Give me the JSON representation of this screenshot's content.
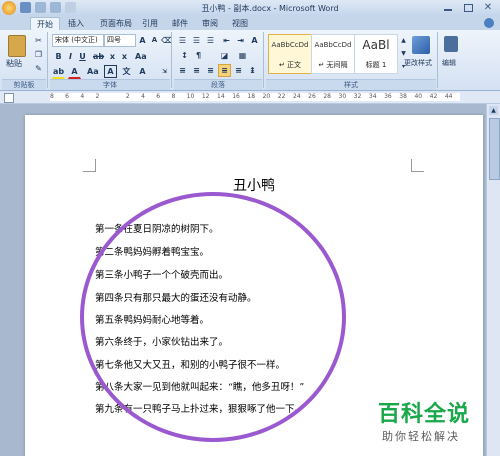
{
  "window": {
    "title": "丑小鸭 - 副本.docx - Microsoft Word"
  },
  "tabs": [
    {
      "label": "开始",
      "active": true
    },
    {
      "label": "插入"
    },
    {
      "label": "页面布局"
    },
    {
      "label": "引用"
    },
    {
      "label": "邮件"
    },
    {
      "label": "审阅"
    },
    {
      "label": "视图"
    }
  ],
  "ribbon": {
    "clipboard": {
      "paste_label": "粘贴",
      "group_label": "剪贴板"
    },
    "font": {
      "font_name": "宋体 (中文正)",
      "font_size": "四号",
      "group_label": "字体"
    },
    "paragraph": {
      "group_label": "段落"
    },
    "styles": {
      "items": [
        {
          "preview": "AaBbCcDd",
          "name": "↵ 正文",
          "selected": true
        },
        {
          "preview": "AaBbCcDd",
          "name": "↵ 无间隔"
        },
        {
          "preview": "AaBl",
          "name": "标题 1"
        }
      ],
      "change_label": "更改样式",
      "group_label": "样式"
    },
    "edit": {
      "label": "编辑"
    }
  },
  "ruler": {
    "ticks": [
      "8",
      "6",
      "4",
      "2",
      "",
      "2",
      "4",
      "6",
      "8",
      "10",
      "12",
      "14",
      "16",
      "18",
      "20",
      "22",
      "24",
      "26",
      "28",
      "30",
      "32",
      "34",
      "36",
      "38",
      "40",
      "42",
      "44"
    ]
  },
  "document": {
    "title": "丑小鸭",
    "lines": [
      "第一条在夏日阴凉的树阴下。",
      "第二条鸭妈妈孵着鸭宝宝。",
      "第三条小鸭子一个个破壳而出。",
      "第四条只有那只最大的蛋还没有动静。",
      "第五条鸭妈妈耐心地等着。",
      "第六条终于，小家伙钻出来了。",
      "第七条他又大又丑，和别的小鸭子很不一样。",
      "第八条大家一见到他就叫起来：“瞧，他多丑呀！”",
      "第九条有一只鸭子马上扑过来，狠狠啄了他一下。"
    ]
  },
  "watermark": {
    "main": "百科全说",
    "sub": "助你轻松解决"
  },
  "colors": {
    "annotation_circle": "#9b59d0",
    "watermark_green": "#18a84a"
  }
}
